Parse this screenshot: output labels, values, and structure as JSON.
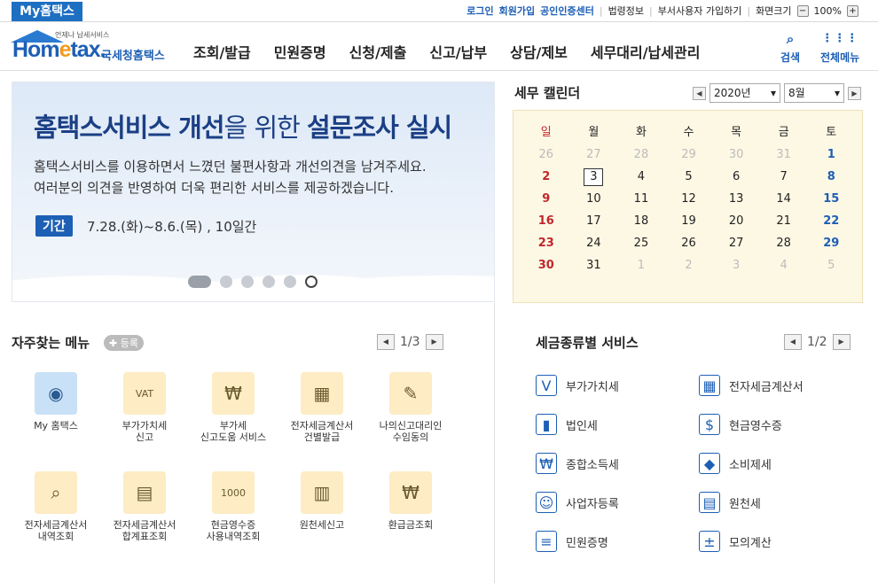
{
  "topbar": {
    "my_tab": "My홈택스",
    "login": "로그인",
    "signup": "회원가입",
    "cert": "공인인증센터",
    "law": "법령정보",
    "dept": "부서사용자 가입하기",
    "screen": "화면크기",
    "zoom": "100%",
    "minus": "−",
    "plus": "+"
  },
  "header": {
    "logo_small": "언제나 납세서비스",
    "logo_main_a": "Hom",
    "logo_main_e": "e",
    "logo_main_b": "tax.",
    "logo_kor": "국세청홈택스",
    "nav": [
      "조회/발급",
      "민원증명",
      "신청/제출",
      "신고/납부",
      "상담/제보",
      "세무대리/납세관리"
    ],
    "search": "검색",
    "allmenu": "전체메뉴"
  },
  "banner": {
    "title_a": "홈택스서비스 개선",
    "title_b": "을 위한 ",
    "title_c": "설문조사 실시",
    "desc1": "홈택스서비스를 이용하면서 느꼈던 불편사항과 개선의견을 남겨주세요.",
    "desc2": "여러분의 의견을 반영하여 더욱 편리한 서비스를 제공하겠습니다.",
    "period_label": "기간",
    "period_value": "7.28.(화)~8.6.(목) , 10일간"
  },
  "calendar": {
    "title": "세무 캘린더",
    "year": "2020년",
    "month": "8월",
    "weekdays": [
      "일",
      "월",
      "화",
      "수",
      "목",
      "금",
      "토"
    ],
    "weeks": [
      [
        "26",
        "27",
        "28",
        "29",
        "30",
        "31",
        "1"
      ],
      [
        "2",
        "3",
        "4",
        "5",
        "6",
        "7",
        "8"
      ],
      [
        "9",
        "10",
        "11",
        "12",
        "13",
        "14",
        "15"
      ],
      [
        "16",
        "17",
        "18",
        "19",
        "20",
        "21",
        "22"
      ],
      [
        "23",
        "24",
        "25",
        "26",
        "27",
        "28",
        "29"
      ],
      [
        "30",
        "31",
        "1",
        "2",
        "3",
        "4",
        "5"
      ]
    ]
  },
  "freq": {
    "title": "자주찾는 메뉴",
    "add": "✚ 등록",
    "page": "1",
    "total": "/3",
    "items": [
      {
        "l1": "My 홈택스",
        "l2": "",
        "icon": "◉"
      },
      {
        "l1": "부가가치세",
        "l2": "신고",
        "icon": "VAT"
      },
      {
        "l1": "부가세",
        "l2": "신고도움 서비스",
        "icon": "₩"
      },
      {
        "l1": "전자세금계산서",
        "l2": "건별발급",
        "icon": "▦"
      },
      {
        "l1": "나의신고대리인",
        "l2": "수임동의",
        "icon": "✎"
      },
      {
        "l1": "전자세금계산서",
        "l2": "내역조회",
        "icon": "⌕"
      },
      {
        "l1": "전자세금계산서",
        "l2": "합계표조회",
        "icon": "▤"
      },
      {
        "l1": "현금영수증",
        "l2": "사용내역조회",
        "icon": "1000"
      },
      {
        "l1": "원천세신고",
        "l2": "",
        "icon": "▥"
      },
      {
        "l1": "환급금조회",
        "l2": "",
        "icon": "₩"
      }
    ]
  },
  "tax": {
    "title": "세금종류별 서비스",
    "page": "1",
    "total": "/2",
    "items": [
      {
        "label": "부가가치세",
        "icon": "V"
      },
      {
        "label": "전자세금계산서",
        "icon": "▦"
      },
      {
        "label": "법인세",
        "icon": "▮"
      },
      {
        "label": "현금영수증",
        "icon": "$"
      },
      {
        "label": "종합소득세",
        "icon": "₩"
      },
      {
        "label": "소비제세",
        "icon": "◆"
      },
      {
        "label": "사업자등록",
        "icon": "☺"
      },
      {
        "label": "원천세",
        "icon": "▤"
      },
      {
        "label": "민원증명",
        "icon": "≡"
      },
      {
        "label": "모의계산",
        "icon": "±"
      }
    ]
  }
}
